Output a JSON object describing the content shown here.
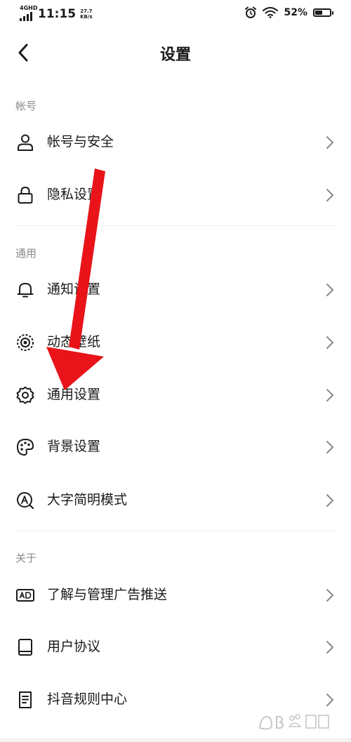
{
  "status_bar": {
    "network": "4GHD",
    "time": "11:15",
    "speed_value": "27.7",
    "speed_unit": "KB/s",
    "battery_text": "52%",
    "battery_level": 0.52
  },
  "header": {
    "title": "设置"
  },
  "sections": [
    {
      "label": "帐号",
      "items": [
        {
          "label": "帐号与安全",
          "icon": "user-icon"
        },
        {
          "label": "隐私设置",
          "icon": "lock-icon"
        }
      ]
    },
    {
      "label": "通用",
      "items": [
        {
          "label": "通知设置",
          "icon": "bell-icon"
        },
        {
          "label": "动态壁纸",
          "icon": "live-wallpaper-icon"
        },
        {
          "label": "通用设置",
          "icon": "gear-icon"
        },
        {
          "label": "背景设置",
          "icon": "palette-icon"
        },
        {
          "label": "大字简明模式",
          "icon": "large-text-icon"
        }
      ]
    },
    {
      "label": "关于",
      "items": [
        {
          "label": "了解与管理广告推送",
          "icon": "ad-icon"
        },
        {
          "label": "用户协议",
          "icon": "book-icon"
        },
        {
          "label": "抖音规则中心",
          "icon": "rules-document-icon"
        }
      ]
    }
  ],
  "colors": {
    "text": "#1a1a1a",
    "section_label": "#8a8a8a",
    "chevron": "#8a8a8a",
    "annotation_arrow": "#e8141a"
  }
}
